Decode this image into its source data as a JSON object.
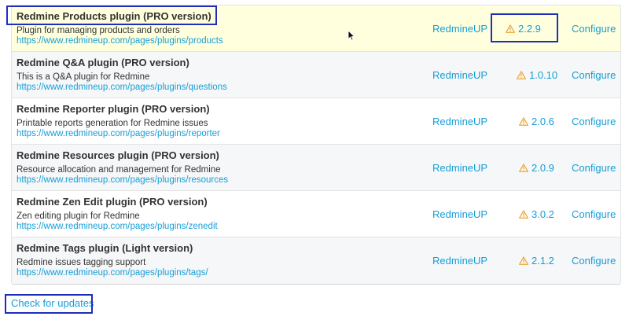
{
  "plugins": [
    {
      "name": "Redmine Products plugin (PRO version)",
      "description": "Plugin for managing products and orders",
      "url": "https://www.redmineup.com/pages/plugins/products",
      "author": "RedmineUP",
      "version": "2.2.9",
      "action": "Configure"
    },
    {
      "name": "Redmine Q&A plugin (PRO version)",
      "description": "This is a Q&A plugin for Redmine",
      "url": "https://www.redmineup.com/pages/plugins/questions",
      "author": "RedmineUP",
      "version": "1.0.10",
      "action": "Configure"
    },
    {
      "name": "Redmine Reporter plugin (PRO version)",
      "description": "Printable reports generation for Redmine issues",
      "url": "https://www.redmineup.com/pages/plugins/reporter",
      "author": "RedmineUP",
      "version": "2.0.6",
      "action": "Configure"
    },
    {
      "name": "Redmine Resources plugin (PRO version)",
      "description": "Resource allocation and management for Redmine",
      "url": "https://www.redmineup.com/pages/plugins/resources",
      "author": "RedmineUP",
      "version": "2.0.9",
      "action": "Configure"
    },
    {
      "name": "Redmine Zen Edit plugin (PRO version)",
      "description": "Zen editing plugin for Redmine",
      "url": "https://www.redmineup.com/pages/plugins/zenedit",
      "author": "RedmineUP",
      "version": "3.0.2",
      "action": "Configure"
    },
    {
      "name": "Redmine Tags plugin (Light version)",
      "description": "Redmine issues tagging support",
      "url": "https://www.redmineup.com/pages/plugins/tags/",
      "author": "RedmineUP",
      "version": "2.1.2",
      "action": "Configure"
    }
  ],
  "check_updates_label": "Check for updates",
  "icons": {
    "version_warning": "warning-triangle-icon",
    "cursor": "mouse-pointer-icon"
  },
  "colors": {
    "link": "#169ed6",
    "warning": "#e8a33a",
    "highlight_row": "#ffffdd",
    "callout": "#1d2fb8"
  }
}
